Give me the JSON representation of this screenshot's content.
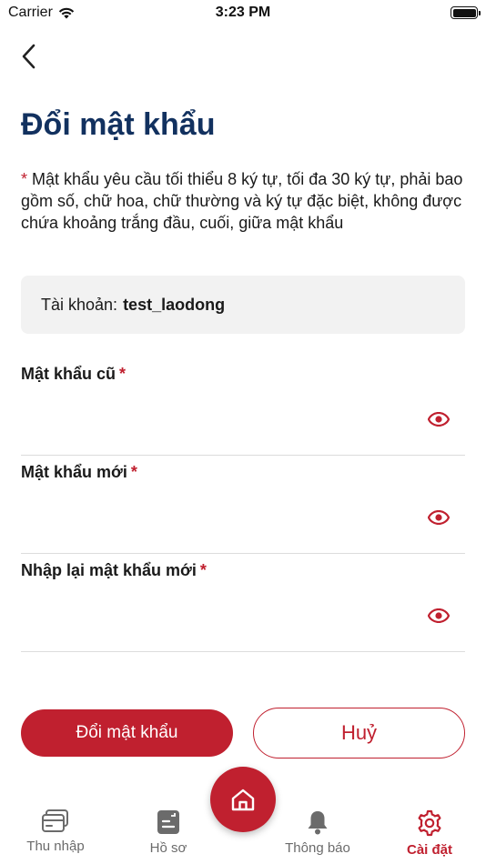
{
  "status_bar": {
    "carrier": "Carrier",
    "time": "3:23 PM"
  },
  "title": "Đổi mật khẩu",
  "requirement": {
    "star": "*",
    "text": " Mật khẩu yêu cầu tối thiểu 8 ký tự, tối đa 30 ký tự, phải bao gồm số, chữ hoa, chữ thường và ký tự đặc biệt, không được chứa khoảng trắng đầu, cuối, giữa mật khẩu"
  },
  "account": {
    "label": "Tài khoản:",
    "value": "test_laodong"
  },
  "fields": [
    {
      "label": "Mật khẩu cũ",
      "required": "*",
      "value": ""
    },
    {
      "label": "Mật khẩu mới",
      "required": "*",
      "value": ""
    },
    {
      "label": "Nhập lại mật khẩu mới",
      "required": "*",
      "value": ""
    }
  ],
  "buttons": {
    "submit": "Đổi mật khẩu",
    "cancel": "Huỷ"
  },
  "tabbar": {
    "items": [
      {
        "label": "Thu nhập",
        "icon": "wallet-card-icon"
      },
      {
        "label": "Hồ sơ",
        "icon": "document-icon"
      },
      {
        "label": "",
        "icon": "home-icon"
      },
      {
        "label": "Thông báo",
        "icon": "bell-icon"
      },
      {
        "label": "Cài đặt",
        "icon": "gear-icon"
      }
    ],
    "active": "Cài đặt"
  },
  "colors": {
    "accent": "#c0202f",
    "title": "#12315f",
    "account_bg": "#f2f2f2"
  }
}
